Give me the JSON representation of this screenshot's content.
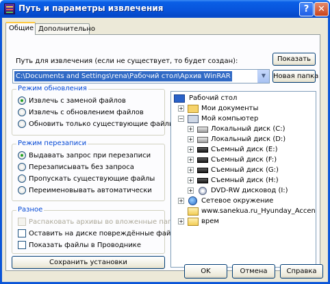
{
  "window": {
    "title": "Путь и параметры извлечения",
    "help_glyph": "?",
    "close_glyph": "✕"
  },
  "tabs": [
    {
      "label": "Общие",
      "selected": true
    },
    {
      "label": "Дополнительно",
      "selected": false
    }
  ],
  "path": {
    "label": "Путь для извлечения (если не существует, то будет создан):",
    "value": "C:\\Documents and Settings\\rena\\Рабочий стол\\Архив WinRAR",
    "show_button": "Показать",
    "new_folder_button": "Новая папка"
  },
  "update_mode": {
    "title": "Режим обновления",
    "options": [
      {
        "label": "Извлечь с заменой файлов",
        "selected": true
      },
      {
        "label": "Извлечь с обновлением файлов",
        "selected": false
      },
      {
        "label": "Обновить только существующие файлы",
        "selected": false
      }
    ]
  },
  "overwrite_mode": {
    "title": "Режим перезаписи",
    "options": [
      {
        "label": "Выдавать запрос при перезаписи",
        "selected": true
      },
      {
        "label": "Перезаписывать без запроса",
        "selected": false
      },
      {
        "label": "Пропускать существующие файлы",
        "selected": false
      },
      {
        "label": "Переименовывать автоматически",
        "selected": false
      }
    ]
  },
  "misc": {
    "title": "Разное",
    "options": [
      {
        "label": "Распаковать архивы во вложенные папки",
        "checked": false,
        "disabled": true
      },
      {
        "label": "Оставить на диске повреждённые файлы",
        "checked": false,
        "disabled": false
      },
      {
        "label": "Показать файлы в Проводнике",
        "checked": false,
        "disabled": false
      }
    ]
  },
  "save_button": "Сохранить установки",
  "tree": {
    "nodes": [
      {
        "label": "Рабочий стол",
        "icon": "desktop-icon",
        "expander": ""
      },
      {
        "label": "Мои документы",
        "icon": "folder-documents-icon",
        "expander": "+"
      },
      {
        "label": "Мой компьютер",
        "icon": "computer-icon",
        "expander": "−"
      },
      {
        "label": "Локальный диск (C:)",
        "icon": "hard-disk-icon",
        "expander": "+"
      },
      {
        "label": "Локальный диск (D:)",
        "icon": "hard-disk-icon",
        "expander": "+"
      },
      {
        "label": "Съемный диск (E:)",
        "icon": "removable-disk-icon",
        "expander": "+"
      },
      {
        "label": "Съемный диск (F:)",
        "icon": "removable-disk-icon",
        "expander": "+"
      },
      {
        "label": "Съемный диск (G:)",
        "icon": "removable-disk-icon",
        "expander": "+"
      },
      {
        "label": "Съемный диск (H:)",
        "icon": "removable-disk-icon",
        "expander": "+"
      },
      {
        "label": "DVD-RW дисковод (I:)",
        "icon": "dvd-drive-icon",
        "expander": "+"
      },
      {
        "label": "Сетевое окружение",
        "icon": "network-icon",
        "expander": "+"
      },
      {
        "label": "www.sanekua.ru_Hyunday_Accent",
        "icon": "folder-icon",
        "expander": ""
      },
      {
        "label": "врем",
        "icon": "folder-icon",
        "expander": "+"
      }
    ]
  },
  "buttons": {
    "ok": "OK",
    "cancel": "Отмена",
    "help": "Справка"
  }
}
